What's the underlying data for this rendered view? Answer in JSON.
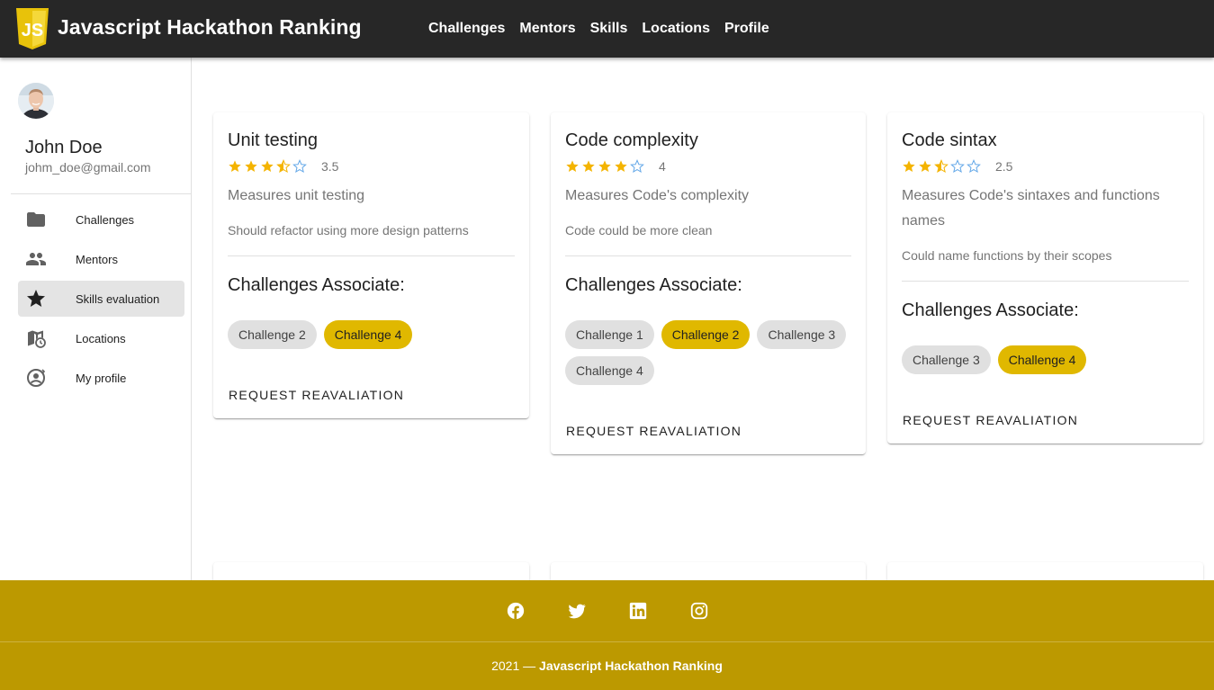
{
  "app": {
    "title": "Javascript Hackathon Ranking",
    "logo_text": "JS",
    "nav": [
      "Challenges",
      "Mentors",
      "Skills",
      "Locations",
      "Profile"
    ]
  },
  "user": {
    "name": "John Doe",
    "email": "johm_doe@gmail.com"
  },
  "sidebar": {
    "items": [
      {
        "label": "Challenges",
        "icon": "folder-icon"
      },
      {
        "label": "Mentors",
        "icon": "people-icon"
      },
      {
        "label": "Skills evaluation",
        "icon": "star-icon",
        "active": true
      },
      {
        "label": "Locations",
        "icon": "map-clock-icon"
      },
      {
        "label": "My profile",
        "icon": "account-cog-icon"
      }
    ]
  },
  "colors": {
    "topbar": "#272727",
    "accent": "#e0b800",
    "footer": "#bc9900",
    "star": "#f4b400"
  },
  "skills": [
    {
      "title": "Unit testing",
      "rating": 3.5,
      "rating_text": "3.5",
      "description": "Measures unit testing",
      "note": "Should refactor using more design patterns",
      "assoc_label": "Challenges Associate:",
      "challenges": [
        {
          "label": "Challenge 2",
          "highlight": false
        },
        {
          "label": "Challenge 4",
          "highlight": true
        }
      ],
      "button": "REQUEST REAVALIATION"
    },
    {
      "title": "Code complexity",
      "rating": 4,
      "rating_text": "4",
      "description": "Measures Code's complexity",
      "note": "Code could be more clean",
      "assoc_label": "Challenges Associate:",
      "challenges": [
        {
          "label": "Challenge 1",
          "highlight": false
        },
        {
          "label": "Challenge 2",
          "highlight": true
        },
        {
          "label": "Challenge 3",
          "highlight": false
        },
        {
          "label": "Challenge 4",
          "highlight": false
        }
      ],
      "button": "REQUEST REAVALIATION"
    },
    {
      "title": "Code sintax",
      "rating": 2.5,
      "rating_text": "2.5",
      "description": "Measures Code's sintaxes and functions names",
      "note": "Could name functions by their scopes",
      "assoc_label": "Challenges Associate:",
      "challenges": [
        {
          "label": "Challenge 3",
          "highlight": false
        },
        {
          "label": "Challenge 4",
          "highlight": true
        }
      ],
      "button": "REQUEST REAVALIATION"
    }
  ],
  "footer": {
    "social": [
      "facebook-icon",
      "twitter-icon",
      "linkedin-icon",
      "instagram-icon"
    ],
    "year": "2021 —",
    "brand": "Javascript Hackathon Ranking"
  }
}
